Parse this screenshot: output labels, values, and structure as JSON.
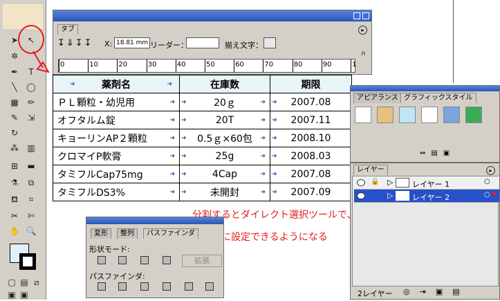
{
  "tab_panel": {
    "title": "タブ",
    "x_label": "X:",
    "x_value": "18.81 mm",
    "leader_label": "リーダー：",
    "align_label": "揃え文字：",
    "ruler_ticks": [
      "0",
      "10",
      "20",
      "30",
      "40",
      "50",
      "60",
      "70",
      "80",
      "90",
      "1"
    ]
  },
  "table": {
    "headers": [
      "薬剤名",
      "在庫数",
      "期限"
    ],
    "rows": [
      [
        "ＰＬ顆粒・幼児用",
        "20ｇ",
        "2007.08"
      ],
      [
        "オフタルム錠",
        "20T",
        "2007.11"
      ],
      [
        "キョーリンAP２顆粒",
        "0.5ｇ×60包",
        "2008.10"
      ],
      [
        "クロマイP軟膏",
        "25g",
        "2008.03"
      ],
      [
        "タミフルCap75mg",
        "4Cap",
        "2007.08"
      ],
      [
        "タミフルDS3%",
        "未開封",
        "2007.09"
      ]
    ]
  },
  "annotation": {
    "line1": "分割するとダイレクト選択ツールで、セルの色を",
    "line2": "個別に設定できるようになる"
  },
  "pathfinder": {
    "tabs": [
      "変形",
      "整列",
      "パスファインダ"
    ],
    "shape_mode_label": "形状モード:",
    "expand_label": "拡張",
    "pathfinder_label": "パスファインダ:"
  },
  "styles_panel": {
    "tabs": [
      "アピアランス",
      "グラフィックスタイル"
    ],
    "swatches": [
      "#ffffff",
      "#e8c080",
      "#bfe4f4",
      "#ffffff",
      "#7aa4dc",
      "#3cac54"
    ]
  },
  "layers_panel": {
    "tab": "レイヤー",
    "layers": [
      "レイヤー 1",
      "レイヤー 2"
    ],
    "footer": "2レイヤー"
  },
  "colors": {
    "accent_red": "#e02020",
    "selection_blue": "#2850c8",
    "header_bg": "#e8f4f8"
  }
}
